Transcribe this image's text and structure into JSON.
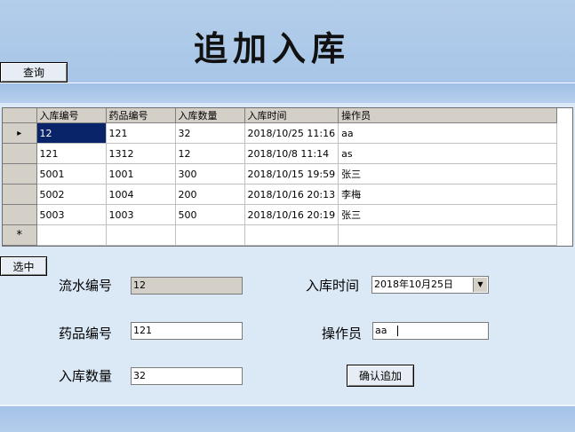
{
  "title": "追加入库",
  "query_button": "查询",
  "select_button": "选中",
  "grid": {
    "columns": [
      "入库编号",
      "药品编号",
      "入库数量",
      "入库时间",
      "操作员"
    ],
    "rows": [
      [
        "12",
        "121",
        "32",
        "2018/10/25 11:16",
        "aa"
      ],
      [
        "121",
        "1312",
        "12",
        "2018/10/8 11:14",
        "as"
      ],
      [
        "5001",
        "1001",
        "300",
        "2018/10/15 19:59",
        "张三"
      ],
      [
        "5002",
        "1004",
        "200",
        "2018/10/16 20:13",
        "李梅"
      ],
      [
        "5003",
        "1003",
        "500",
        "2018/10/16 20:19",
        "张三"
      ]
    ],
    "current_row_marker": "▸",
    "new_row_marker": "*"
  },
  "form": {
    "serial_label": "流水编号",
    "serial_value": "12",
    "drug_label": "药品编号",
    "drug_value": "121",
    "qty_label": "入库数量",
    "qty_value": "32",
    "time_label": "入库时间",
    "time_value": "2018年10月25日",
    "operator_label": "操作员",
    "operator_value": "aa",
    "confirm_button": "确认追加"
  },
  "icons": {
    "combo_arrow": "chevron-down-icon"
  }
}
